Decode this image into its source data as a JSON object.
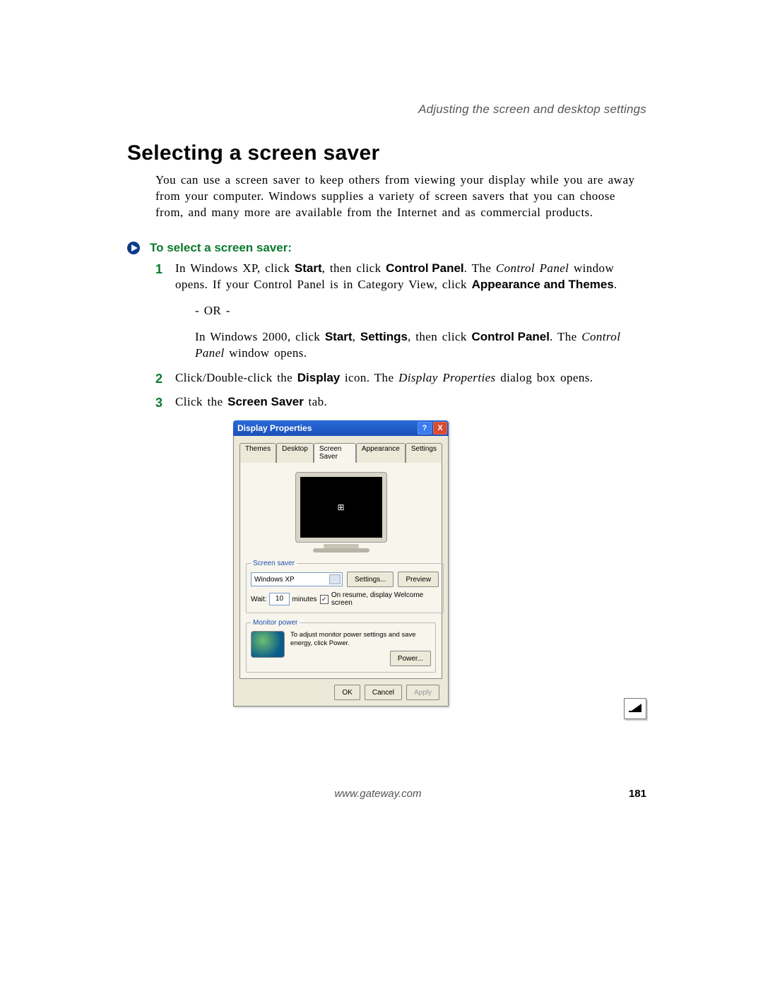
{
  "chapter_line": "Adjusting the screen and desktop settings",
  "section_title": "Selecting a screen saver",
  "intro": "You can use a screen saver to keep others from viewing your display while you are away from your computer. Windows supplies a variety of screen savers that you can choose from, and many more are available from the Internet and as commercial products.",
  "task_title": "To select a screen saver:",
  "steps": {
    "s1": {
      "num": "1",
      "t1": "In Windows XP, click ",
      "b1": "Start",
      "t2": ", then click ",
      "b2": "Control Panel",
      "t3": ". The ",
      "i1": "Control Panel",
      "t4": " window opens. If your Control Panel is in Category View, click ",
      "b3": "Appearance and Themes",
      "t5": ".",
      "or": "- OR -",
      "t6": "In Windows 2000, click ",
      "b4": "Start",
      "t7": ", ",
      "b5": "Settings",
      "t8": ", then click ",
      "b6": "Control Panel",
      "t9": ". The ",
      "i2": "Control Panel",
      "t10": " window opens."
    },
    "s2": {
      "num": "2",
      "t1": "Click/Double-click the ",
      "b1": "Display",
      "t2": " icon. The ",
      "i1": "Display Properties",
      "t3": " dialog box opens."
    },
    "s3": {
      "num": "3",
      "t1": "Click the ",
      "b1": "Screen Saver",
      "t2": " tab."
    }
  },
  "dialog": {
    "title": "Display Properties",
    "help": "?",
    "close": "X",
    "tabs": {
      "themes": "Themes",
      "desktop": "Desktop",
      "screensaver": "Screen Saver",
      "appearance": "Appearance",
      "settings": "Settings"
    },
    "ss_group": "Screen saver",
    "ss_selected": "Windows XP",
    "btn_settings": "Settings...",
    "btn_preview": "Preview",
    "wait_label": "Wait:",
    "wait_value": "10",
    "wait_unit": "minutes",
    "resume_chk": "On resume, display Welcome screen",
    "mp_group": "Monitor power",
    "mp_text": "To adjust monitor power settings and save energy, click Power.",
    "btn_power": "Power...",
    "btn_ok": "OK",
    "btn_cancel": "Cancel",
    "btn_apply": "Apply"
  },
  "footer": {
    "url": "www.gateway.com",
    "page": "181"
  }
}
